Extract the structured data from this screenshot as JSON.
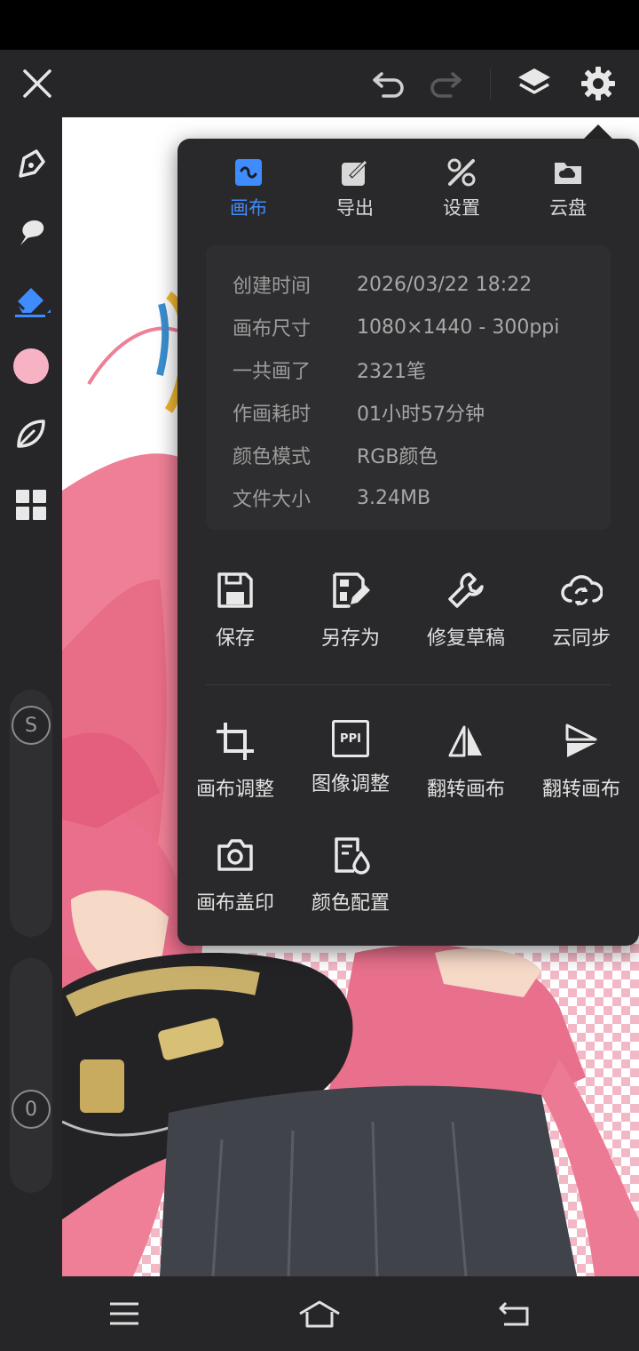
{
  "toolbar": {
    "close": "close-icon",
    "undo": "undo-icon",
    "redo": "redo-icon",
    "layers": "layers-icon",
    "settings": "gear-icon"
  },
  "left_tools": {
    "tools": [
      "pen-icon",
      "smudge-icon",
      "eraser-icon",
      "color-swatch",
      "leaf-icon",
      "grid-icon"
    ],
    "color_hex": "#f7b3c4",
    "size_slider_label": "S",
    "opacity_slider_label": "0"
  },
  "popup": {
    "tabs": [
      {
        "label": "画布",
        "icon": "canvas-icon"
      },
      {
        "label": "导出",
        "icon": "export-icon"
      },
      {
        "label": "设置",
        "icon": "tools-icon"
      },
      {
        "label": "云盘",
        "icon": "cloud-folder-icon"
      }
    ],
    "active_tab": "画布",
    "info": [
      {
        "label": "创建时间",
        "value": "2026/03/22 18:22"
      },
      {
        "label": "画布尺寸",
        "value": "1080×1440 - 300ppi"
      },
      {
        "label": "一共画了",
        "value": "2321笔"
      },
      {
        "label": "作画耗时",
        "value": "01小时57分钟"
      },
      {
        "label": "颜色模式",
        "value": "RGB颜色"
      },
      {
        "label": "文件大小",
        "value": "3.24MB"
      }
    ],
    "actions_row1": [
      {
        "label": "保存",
        "icon": "save-icon"
      },
      {
        "label": "另存为",
        "icon": "save-as-icon"
      },
      {
        "label": "修复草稿",
        "icon": "wrench-icon"
      },
      {
        "label": "云同步",
        "icon": "cloud-sync-icon"
      }
    ],
    "actions_row2": [
      {
        "label": "画布调整",
        "icon": "crop-icon"
      },
      {
        "label": "图像调整",
        "icon": "ppi-icon"
      },
      {
        "label": "翻转画布",
        "icon": "flip-horizontal-icon"
      },
      {
        "label": "翻转画布",
        "icon": "flip-vertical-icon"
      }
    ],
    "actions_row3": [
      {
        "label": "画布盖印",
        "icon": "stamp-camera-icon"
      },
      {
        "label": "颜色配置",
        "icon": "color-config-icon"
      }
    ],
    "ppi_text": "PPI"
  },
  "nav": {
    "menu": "menu-icon",
    "home": "home-icon",
    "back": "back-icon"
  },
  "colors": {
    "accent": "#3f8cff",
    "panel": "#29292b",
    "toolbar": "#262628"
  }
}
